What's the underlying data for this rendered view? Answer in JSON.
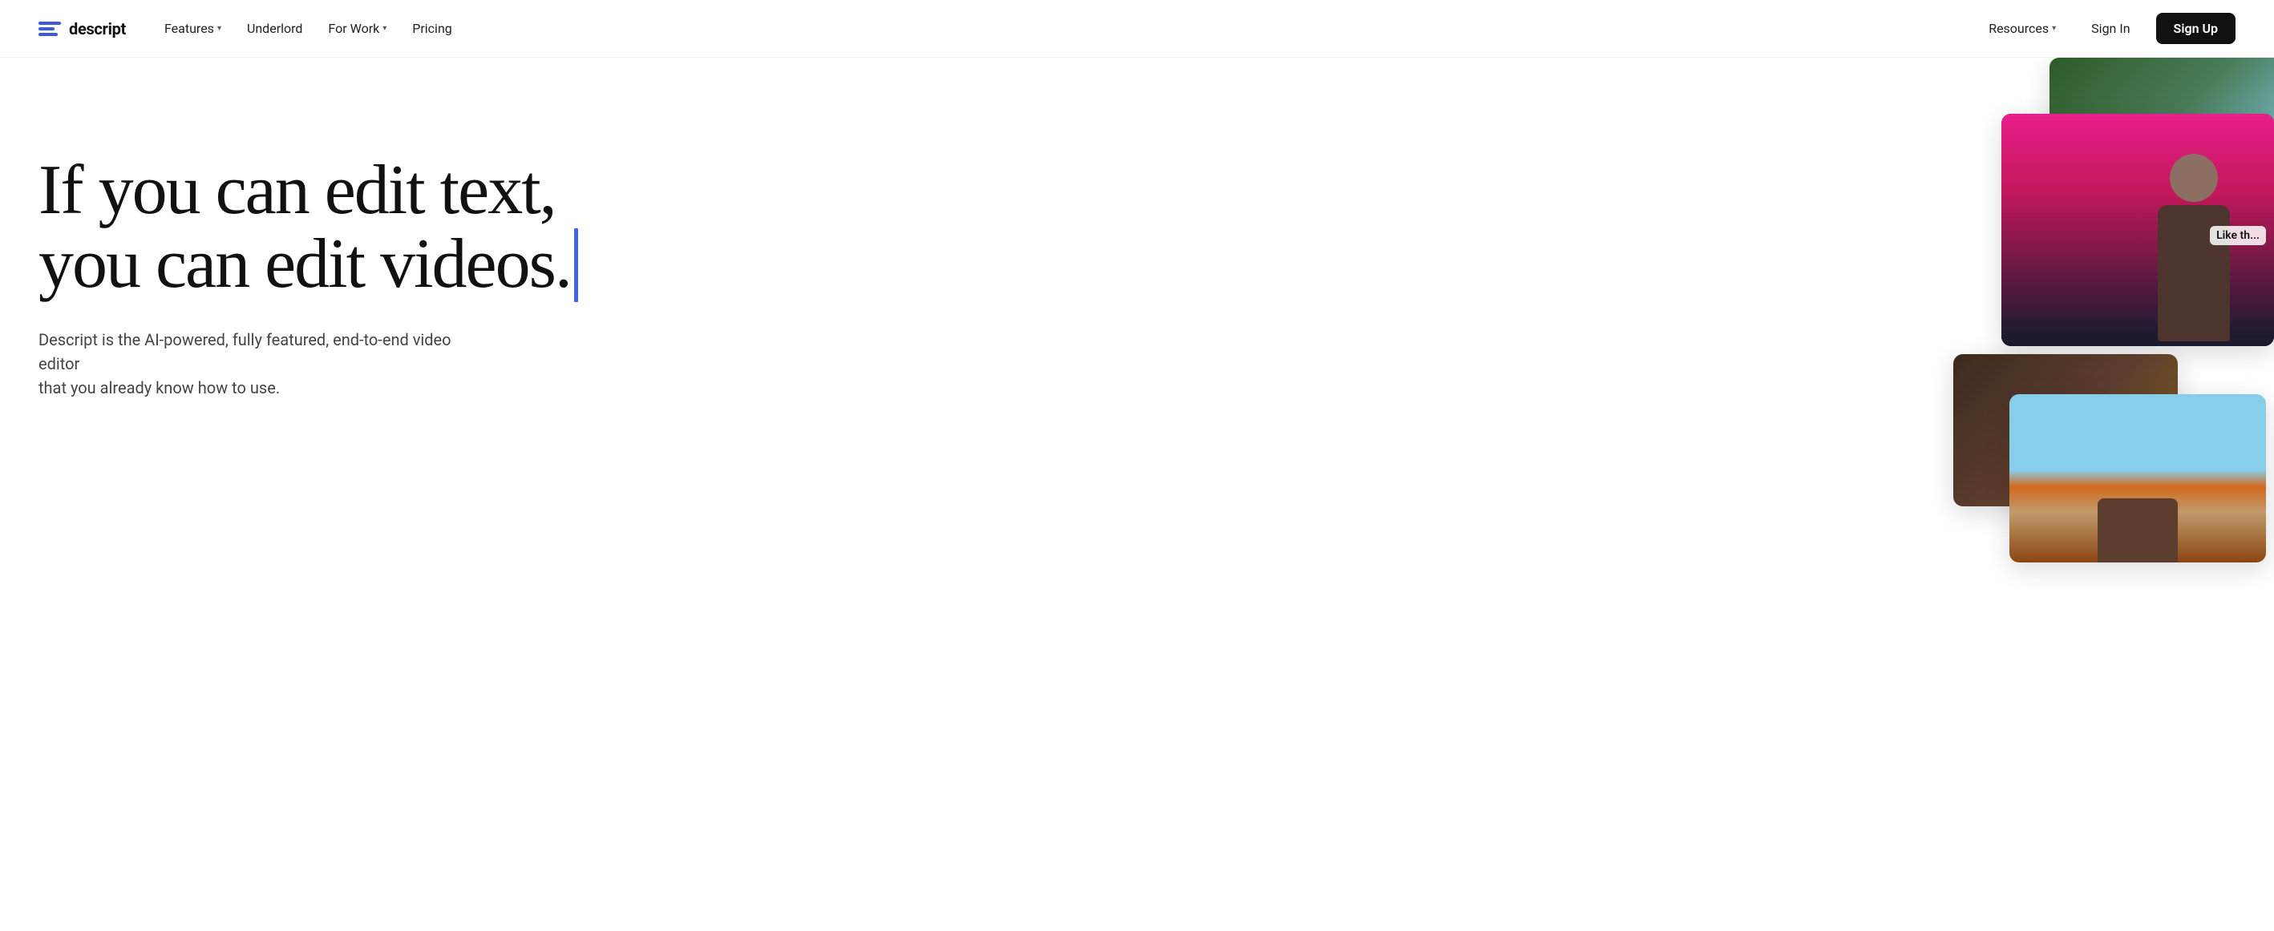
{
  "brand": {
    "name": "descript",
    "logo_alt": "Descript logo"
  },
  "navbar": {
    "links": [
      {
        "id": "features",
        "label": "Features",
        "has_dropdown": true
      },
      {
        "id": "underlord",
        "label": "Underlord",
        "has_dropdown": false
      },
      {
        "id": "for-work",
        "label": "For Work",
        "has_dropdown": true
      },
      {
        "id": "pricing",
        "label": "Pricing",
        "has_dropdown": false
      }
    ],
    "right_links": [
      {
        "id": "resources",
        "label": "Resources",
        "has_dropdown": true
      }
    ],
    "sign_in_label": "Sign In",
    "sign_up_label": "Sign Up"
  },
  "hero": {
    "headline_line1": "If you can edit text,",
    "headline_line2": "you can edit videos.",
    "subtext_line1": "Descript is the AI-powered, fully featured, end-to-end video editor",
    "subtext_line2": "that you already know how to use."
  },
  "images": {
    "card1_alt": "landscape photo",
    "card2_alt": "person portrait with pink background",
    "card3_alt": "desert landscape"
  },
  "colors": {
    "cursor": "#4263eb",
    "logo": "#3b5bdb",
    "signup_bg": "#111111",
    "nav_text": "#222222"
  }
}
